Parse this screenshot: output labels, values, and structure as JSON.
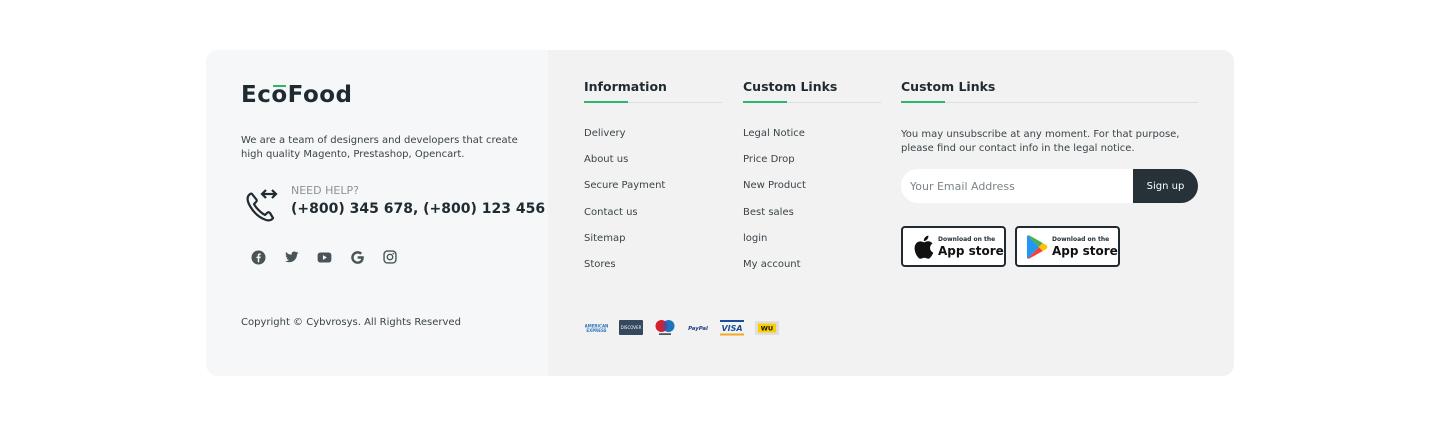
{
  "brand": {
    "logo_text_a": "Ec",
    "logo_text_o": "o",
    "logo_text_b": "Food"
  },
  "about": {
    "text": "We are a team of designers and developers that create high quality Magento, Prestashop, Opencart."
  },
  "help": {
    "label": "NEED HELP?",
    "phone": "(+800) 345 678, (+800) 123 456",
    "icon": "phone-transfer-icon"
  },
  "socials": [
    {
      "icon": "facebook-icon"
    },
    {
      "icon": "twitter-icon"
    },
    {
      "icon": "youtube-icon"
    },
    {
      "icon": "google-icon"
    },
    {
      "icon": "instagram-icon"
    }
  ],
  "copyright": "Copyright © Cybvrosys. All Rights Reserved",
  "columns": {
    "information": {
      "title": "Information",
      "links": [
        "Delivery",
        "About us",
        "Secure Payment",
        "Contact us",
        "Sitemap",
        "Stores"
      ]
    },
    "custom": {
      "title": "Custom Links",
      "links": [
        "Legal Notice",
        "Price Drop",
        "New Product",
        "Best sales",
        "login",
        "My account"
      ]
    },
    "newsletter": {
      "title": "Custom Links",
      "text": "You may unsubscribe at any moment. For that purpose, please find our contact info in the legal notice.",
      "email_placeholder": "Your Email Address",
      "signup_label": "Sign up"
    }
  },
  "stores": [
    {
      "small": "Download on the",
      "big": "App store",
      "icon": "apple-icon"
    },
    {
      "small": "Download on the",
      "big": "App store",
      "icon": "google-play-icon"
    }
  ],
  "payments": [
    "amex-icon",
    "discover-icon",
    "maestro-icon",
    "paypal-icon",
    "visa-icon",
    "western-union-icon"
  ],
  "colors": {
    "accent": "#2fb46e",
    "dark": "#263238",
    "left_bg": "#f5f7f8",
    "right_bg": "#f2f2f2"
  }
}
